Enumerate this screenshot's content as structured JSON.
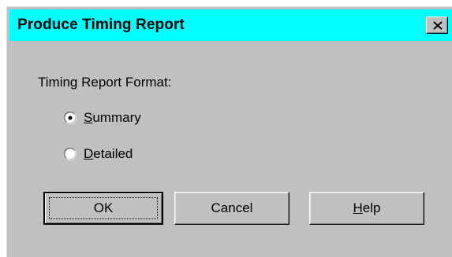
{
  "window": {
    "title": "Produce Timing Report",
    "close_label": "Close"
  },
  "group": {
    "label": "Timing Report Format:"
  },
  "options": [
    {
      "mnemonic": "S",
      "rest": "ummary",
      "selected": true
    },
    {
      "mnemonic": "D",
      "rest": "etailed",
      "selected": false
    }
  ],
  "buttons": {
    "ok": "OK",
    "cancel": "Cancel",
    "help_mnemonic": "H",
    "help_rest": "elp"
  },
  "colors": {
    "titlebar": "#00ffff",
    "face": "#c0c0c0"
  }
}
